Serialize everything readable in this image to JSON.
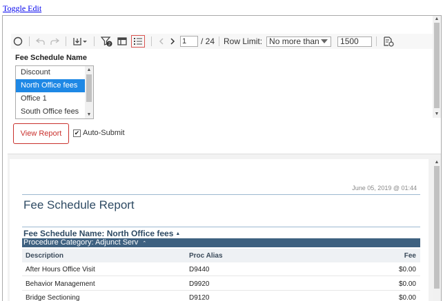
{
  "toggle_edit": "Toggle Edit",
  "toolbar": {
    "filter_badge": "2",
    "page_current": "1",
    "page_total": "/ 24",
    "row_limit_label": "Row Limit:",
    "row_limit_mode": "No more than",
    "row_limit_value": "1500"
  },
  "parameter": {
    "label": "Fee Schedule Name",
    "options": [
      "Discount",
      "North Office fees",
      "Office 1",
      "South Office fees"
    ],
    "selected": "North Office fees"
  },
  "view_report_label": "View Report",
  "auto_submit_label": "Auto-Submit",
  "report": {
    "date": "June 05, 2019 @ 01:44",
    "title": "Fee Schedule Report",
    "group1": "Fee Schedule Name: North Office  fees",
    "group2": "Procedure Category: Adjunct Serv",
    "columns": [
      "Description",
      "Proc Alias",
      "Fee"
    ],
    "rows": [
      {
        "description": "After Hours Office Visit",
        "alias": "D9440",
        "fee": "$0.00"
      },
      {
        "description": "Behavior Management",
        "alias": "D9920",
        "fee": "$0.00"
      },
      {
        "description": "Bridge Sectioning",
        "alias": "D9120",
        "fee": "$0.00"
      }
    ]
  }
}
